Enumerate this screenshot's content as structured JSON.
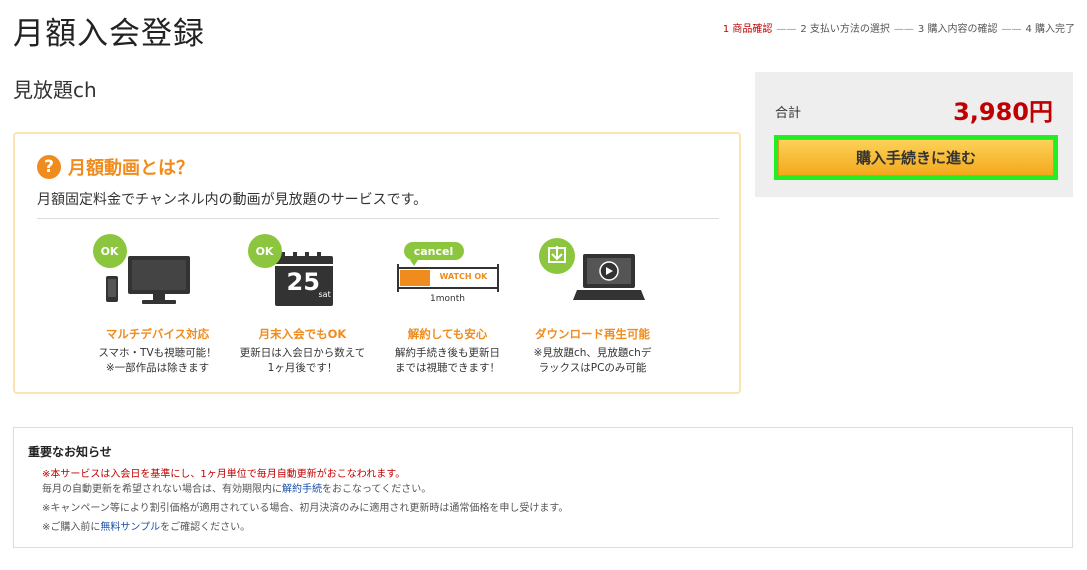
{
  "page": {
    "title": "月額入会登録"
  },
  "steps": [
    {
      "label": "1 商品確認",
      "active": true
    },
    {
      "label": "2 支払い方法の選択",
      "active": false
    },
    {
      "label": "3 購入内容の確認",
      "active": false
    },
    {
      "label": "4 購入完了",
      "active": false
    }
  ],
  "product": {
    "name": "見放題ch"
  },
  "info": {
    "title": "月額動画とは？",
    "description": "月額固定料金でチャンネル内の動画が見放題のサービスです。",
    "features": [
      {
        "title": "マルチデバイス対応",
        "desc": "スマホ・TVも視聴可能！\n※一部作品は除きます",
        "badge": "OK",
        "icon": "tv-smartphone-icon"
      },
      {
        "title": "月末入会でもOK",
        "desc": "更新日は入会日から数えて\n1ヶ月後です！",
        "badge": "OK",
        "icon": "calendar-icon",
        "calendar_day": "25",
        "calendar_weekday": "sat"
      },
      {
        "title": "解約しても安心",
        "desc": "解約手続き後も更新日\nまでは視聴できます！",
        "badge": "cancel",
        "icon": "timeline-icon",
        "bar_label": "WATCH OK",
        "period_label": "1month"
      },
      {
        "title": "ダウンロード再生可能",
        "desc": "※見放題ch、見放題chデ\nラックスはPCのみ可能",
        "badge": "",
        "icon": "laptop-play-icon"
      }
    ]
  },
  "purchase": {
    "total_label": "合計",
    "total_price": "3,980円",
    "button_label": "購入手続きに進む"
  },
  "notice": {
    "title": "重要なお知らせ",
    "line1": "※本サービスは入会日を基準にし、1ヶ月単位で毎月自動更新がおこなわれます。",
    "line2_pre": "毎月の自動更新を希望されない場合は、有効期限内に",
    "line2_link": "解約手続",
    "line2_post": "をおこなってください。",
    "line3": "※キャンペーン等により割引価格が適用されている場合、初月決済のみに適用され更新時は通常価格を申し受けます。",
    "line4_pre": "※ご購入前に",
    "line4_link": "無料サンプル",
    "line4_post": "をご確認ください。"
  },
  "colors": {
    "accent": "#f08c1e",
    "price": "#c00000",
    "ok_badge": "#8cc63f",
    "highlight": "#22ee22"
  }
}
